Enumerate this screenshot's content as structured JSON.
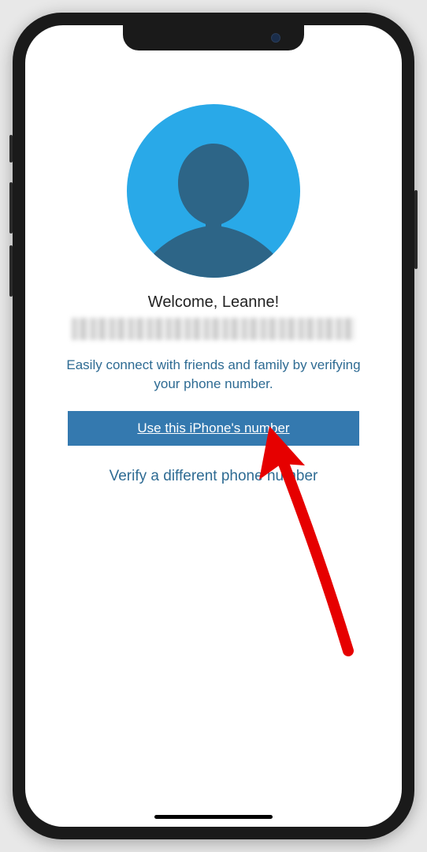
{
  "welcome": {
    "greeting": "Welcome, Leanne!"
  },
  "description": "Easily connect with friends and family by verifying your phone number.",
  "actions": {
    "primary": "Use this iPhone's number",
    "secondary": "Verify a different phone number"
  },
  "colors": {
    "avatar_bg": "#29a9e8",
    "avatar_fill": "#2d6587",
    "button_bg": "#3479af",
    "text_accent": "#2e6b93",
    "arrow": "#e60000"
  }
}
